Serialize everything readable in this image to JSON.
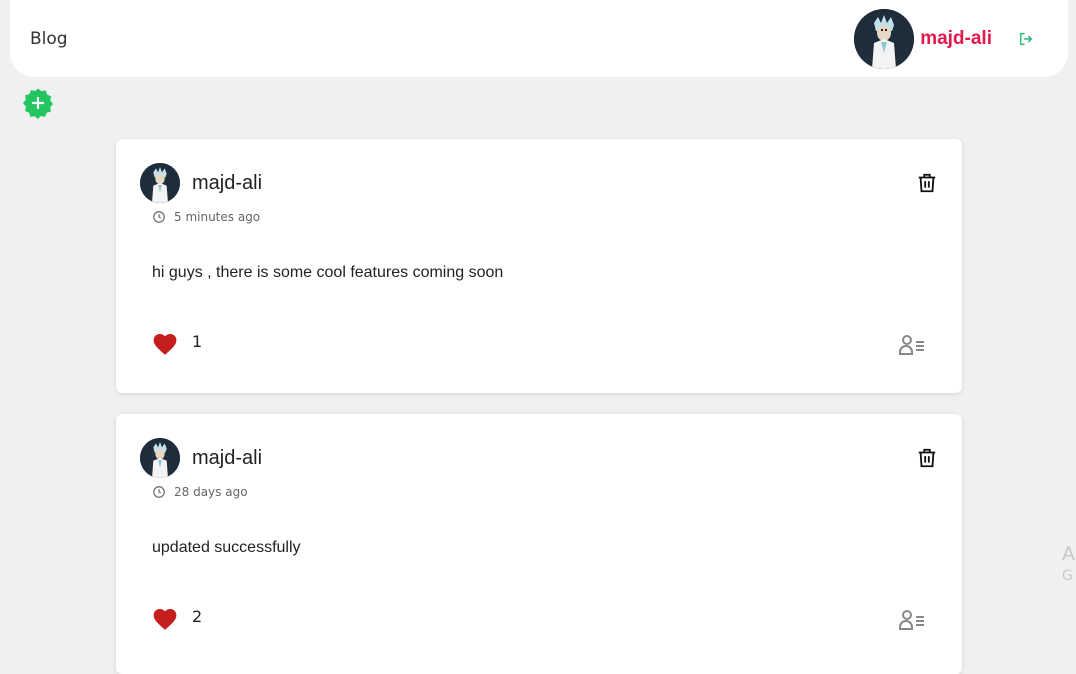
{
  "header": {
    "brand": "Blog",
    "username": "majd-ali",
    "avatar_icon": "user-avatar",
    "logout_icon": "logout-icon",
    "accent_color": "#e3194e"
  },
  "add_post": {
    "icon": "plus-badge-icon",
    "color": "#22c55e"
  },
  "posts": [
    {
      "author": "majd-ali",
      "time": "5 minutes ago",
      "content": "hi guys , there is some cool features coming soon",
      "likes": "1"
    },
    {
      "author": "majd-ali",
      "time": "28 days ago",
      "content": "updated successfully",
      "likes": "2"
    }
  ],
  "edge_overlay": {
    "line1": "A",
    "line2": "G"
  }
}
